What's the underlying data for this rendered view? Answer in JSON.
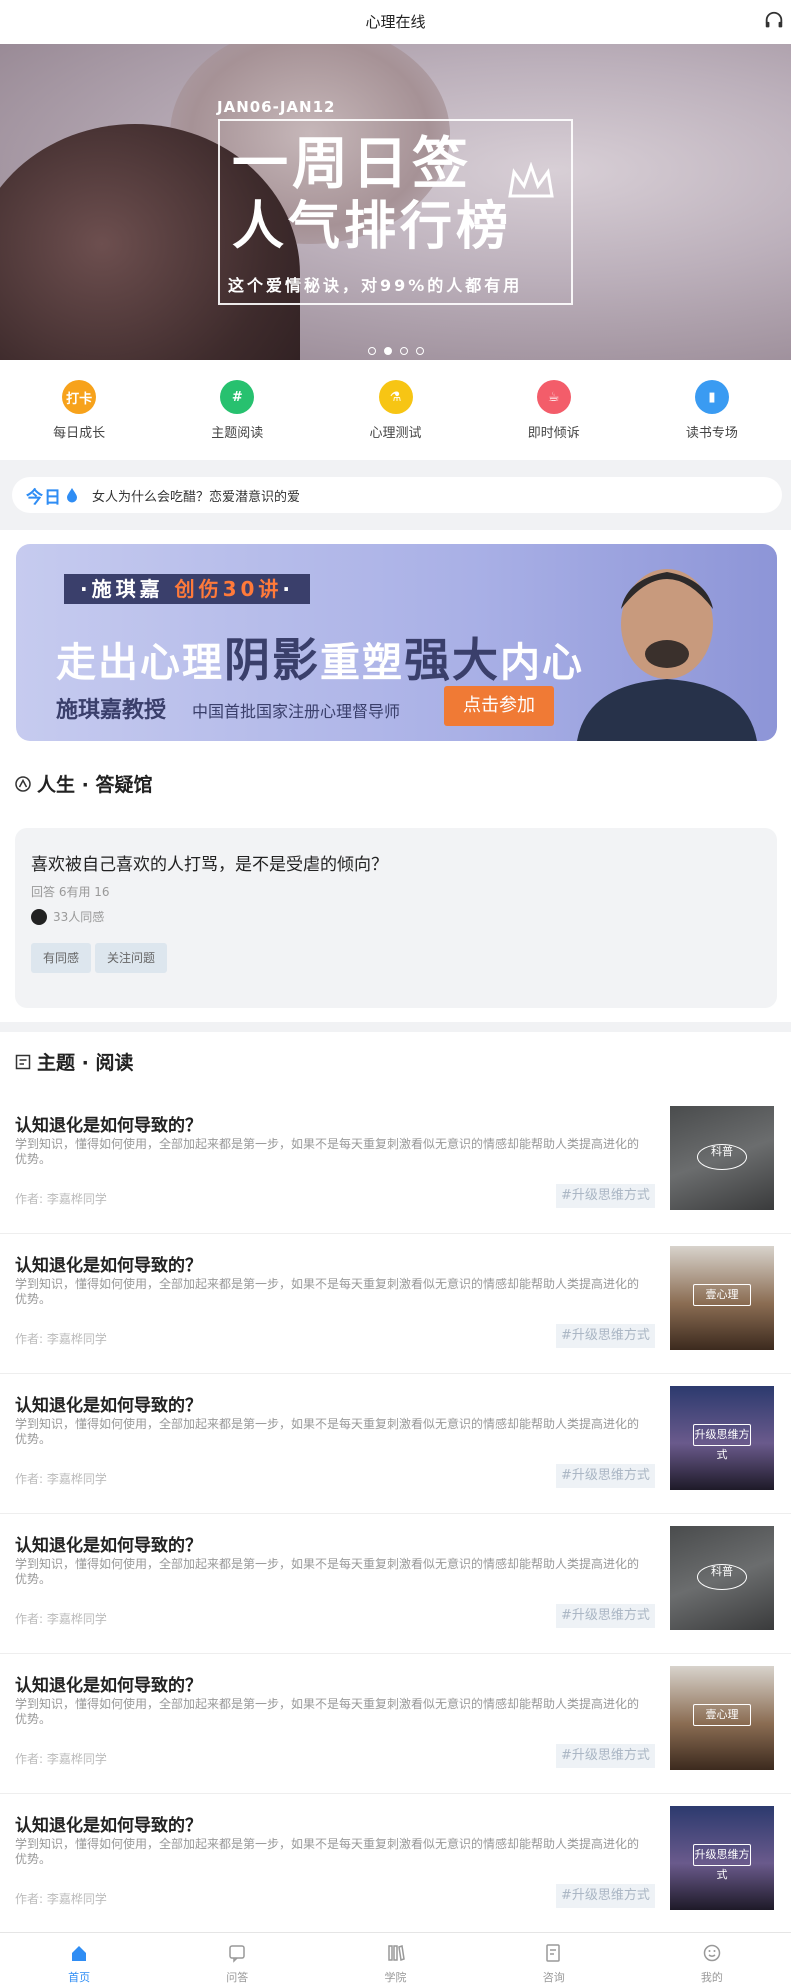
{
  "header": {
    "title": "心理在线",
    "icon": "headset-icon"
  },
  "banner": {
    "date": "JAN06-JAN12",
    "line1": "一周日签",
    "line2": "人气排行榜",
    "subtitle": "这个爱情秘诀，对99%的人都有用",
    "dots": 4,
    "active_dot": 1
  },
  "quick_nav": [
    {
      "label": "每日成长",
      "icon_text": "打卡",
      "color": "#f7a21b"
    },
    {
      "label": "主题阅读",
      "icon_text": "#",
      "color": "#27c16f"
    },
    {
      "label": "心理测试",
      "icon_text": "⚗",
      "color": "#f7c514"
    },
    {
      "label": "即时倾诉",
      "icon_text": "☕",
      "color": "#f35d6a"
    },
    {
      "label": "读书专场",
      "icon_text": "▮",
      "color": "#3a9bf2"
    }
  ],
  "daily": {
    "tag": "今日",
    "text": "女人为什么会吃醋？恋爱潜意识的爱"
  },
  "ad": {
    "tag_name": "施琪嘉",
    "tag_highlight": "创伤30讲",
    "headline_a": "走出心理",
    "headline_b": "阴影",
    "headline_c": "重塑",
    "headline_d": "强大",
    "headline_e": "内心",
    "name": "施琪嘉教授",
    "desc": "中国首批国家注册心理督导师",
    "button": "点击参加"
  },
  "qa_section": {
    "title": "人生 · 答疑馆",
    "question": "喜欢被自己喜欢的人打骂，是不是受虐的倾向？",
    "meta": "回答 6有用 16",
    "agree": "33人同感",
    "btn1": "有同感",
    "btn2": "关注问题"
  },
  "reading_section": {
    "title": "主题 · 阅读",
    "articles": [
      {
        "title": "认知退化是如何导致的？",
        "desc": "学到知识，懂得如何使用，全部加起来都是第一步，如果不是每天重复刺激看似无意识的情感却能帮助人类提高进化的优势。",
        "author": "作者: 李嘉桦同学",
        "tag": "#升级思维方式",
        "thumb_text": "科普",
        "thumb_style": "gray"
      },
      {
        "title": "认知退化是如何导致的？",
        "desc": "学到知识，懂得如何使用，全部加起来都是第一步，如果不是每天重复刺激看似无意识的情感却能帮助人类提高进化的优势。",
        "author": "作者: 李嘉桦同学",
        "tag": "#升级思维方式",
        "thumb_text": "壹心理",
        "thumb_style": "warm"
      },
      {
        "title": "认知退化是如何导致的？",
        "desc": "学到知识，懂得如何使用，全部加起来都是第一步，如果不是每天重复刺激看似无意识的情感却能帮助人类提高进化的优势。",
        "author": "作者: 李嘉桦同学",
        "tag": "#升级思维方式",
        "thumb_text": "升级思维方式",
        "thumb_style": "night"
      },
      {
        "title": "认知退化是如何导致的？",
        "desc": "学到知识，懂得如何使用，全部加起来都是第一步，如果不是每天重复刺激看似无意识的情感却能帮助人类提高进化的优势。",
        "author": "作者: 李嘉桦同学",
        "tag": "#升级思维方式",
        "thumb_text": "科普",
        "thumb_style": "gray"
      },
      {
        "title": "认知退化是如何导致的？",
        "desc": "学到知识，懂得如何使用，全部加起来都是第一步，如果不是每天重复刺激看似无意识的情感却能帮助人类提高进化的优势。",
        "author": "作者: 李嘉桦同学",
        "tag": "#升级思维方式",
        "thumb_text": "壹心理",
        "thumb_style": "warm"
      },
      {
        "title": "认知退化是如何导致的？",
        "desc": "学到知识，懂得如何使用，全部加起来都是第一步，如果不是每天重复刺激看似无意识的情感却能帮助人类提高进化的优势。",
        "author": "作者: 李嘉桦同学",
        "tag": "#升级思维方式",
        "thumb_text": "升级思维方式",
        "thumb_style": "night"
      }
    ]
  },
  "tabbar": [
    {
      "label": "首页",
      "icon": "home-icon",
      "active": true
    },
    {
      "label": "问答",
      "icon": "chat-icon",
      "active": false
    },
    {
      "label": "学院",
      "icon": "books-icon",
      "active": false
    },
    {
      "label": "咨询",
      "icon": "edit-doc-icon",
      "active": false
    },
    {
      "label": "我的",
      "icon": "smile-icon",
      "active": false
    }
  ],
  "colors": {
    "accent": "#2f8df4",
    "ad_button": "#f07a35",
    "ad_dark": "#3a3f6b"
  }
}
